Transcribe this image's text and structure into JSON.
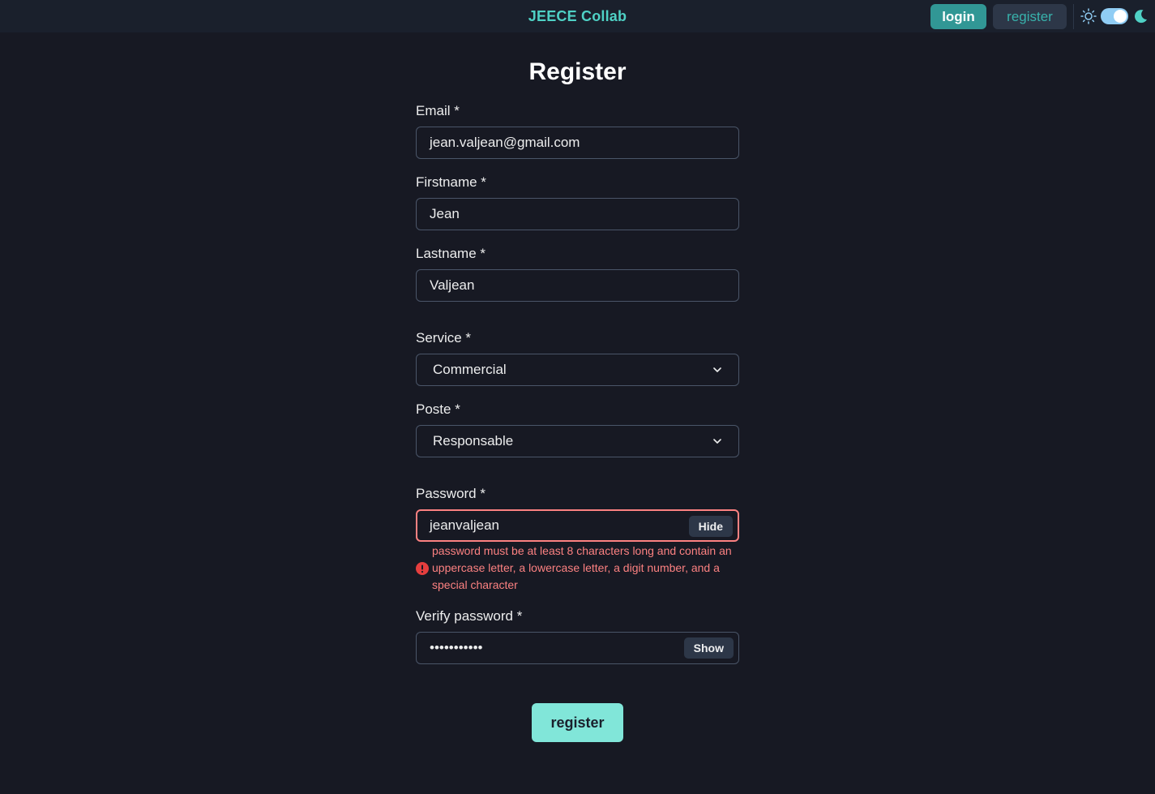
{
  "header": {
    "brand": "JEECE Collab",
    "login_label": "login",
    "register_label": "register",
    "theme": "dark"
  },
  "form": {
    "title": "Register",
    "email": {
      "label": "Email *",
      "value": "jean.valjean@gmail.com"
    },
    "firstname": {
      "label": "Firstname *",
      "value": "Jean"
    },
    "lastname": {
      "label": "Lastname *",
      "value": "Valjean"
    },
    "service": {
      "label": "Service *",
      "value": "Commercial"
    },
    "poste": {
      "label": "Poste *",
      "value": "Responsable"
    },
    "password": {
      "label": "Password *",
      "value": "jeanvaljean",
      "toggle_label": "Hide",
      "error": "password must be at least 8 characters long and contain an uppercase letter, a lowercase letter, a digit number, and a special character"
    },
    "verify_password": {
      "label": "Verify password *",
      "value": "•••••••••••",
      "toggle_label": "Show"
    },
    "submit_label": "register"
  },
  "colors": {
    "background": "#171923",
    "accent": "#319795",
    "accent_light": "#81e6d9",
    "error": "#fc8181"
  }
}
